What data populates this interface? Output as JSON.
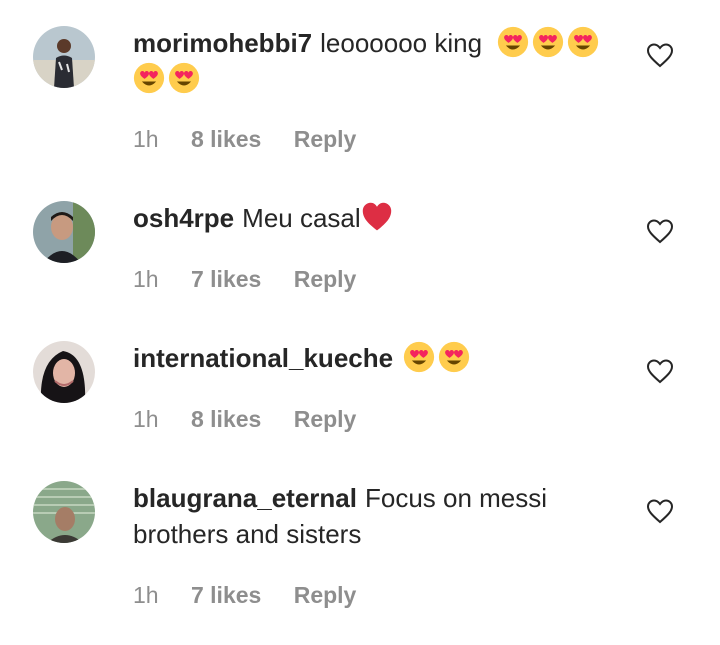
{
  "comments": [
    {
      "username": "morimohebbi7",
      "text": "leoooooo king",
      "emojis": [
        "heart-eyes-emoji",
        "heart-eyes-emoji",
        "heart-eyes-emoji",
        "heart-eyes-emoji",
        "heart-eyes-emoji"
      ],
      "time": "1h",
      "likes": "8 likes",
      "reply": "Reply"
    },
    {
      "username": "osh4rpe",
      "text": "Meu casal",
      "emojis": [
        "red-heart-emoji"
      ],
      "time": "1h",
      "likes": "7 likes",
      "reply": "Reply"
    },
    {
      "username": "international_kueche",
      "text": "",
      "emojis": [
        "heart-eyes-emoji",
        "heart-eyes-emoji"
      ],
      "time": "1h",
      "likes": "8 likes",
      "reply": "Reply"
    },
    {
      "username": "blaugrana_eternal",
      "text": "Focus on messi brothers and sisters",
      "emojis": [],
      "time": "1h",
      "likes": "7 likes",
      "reply": "Reply"
    }
  ],
  "colors": {
    "text": "#262626",
    "meta": "#8e8e8e",
    "emoji_face": "#ffcc4d",
    "emoji_heart": "#f4245e",
    "red_heart": "#dd2e44"
  },
  "icons": {
    "like": "heart-outline-icon"
  }
}
